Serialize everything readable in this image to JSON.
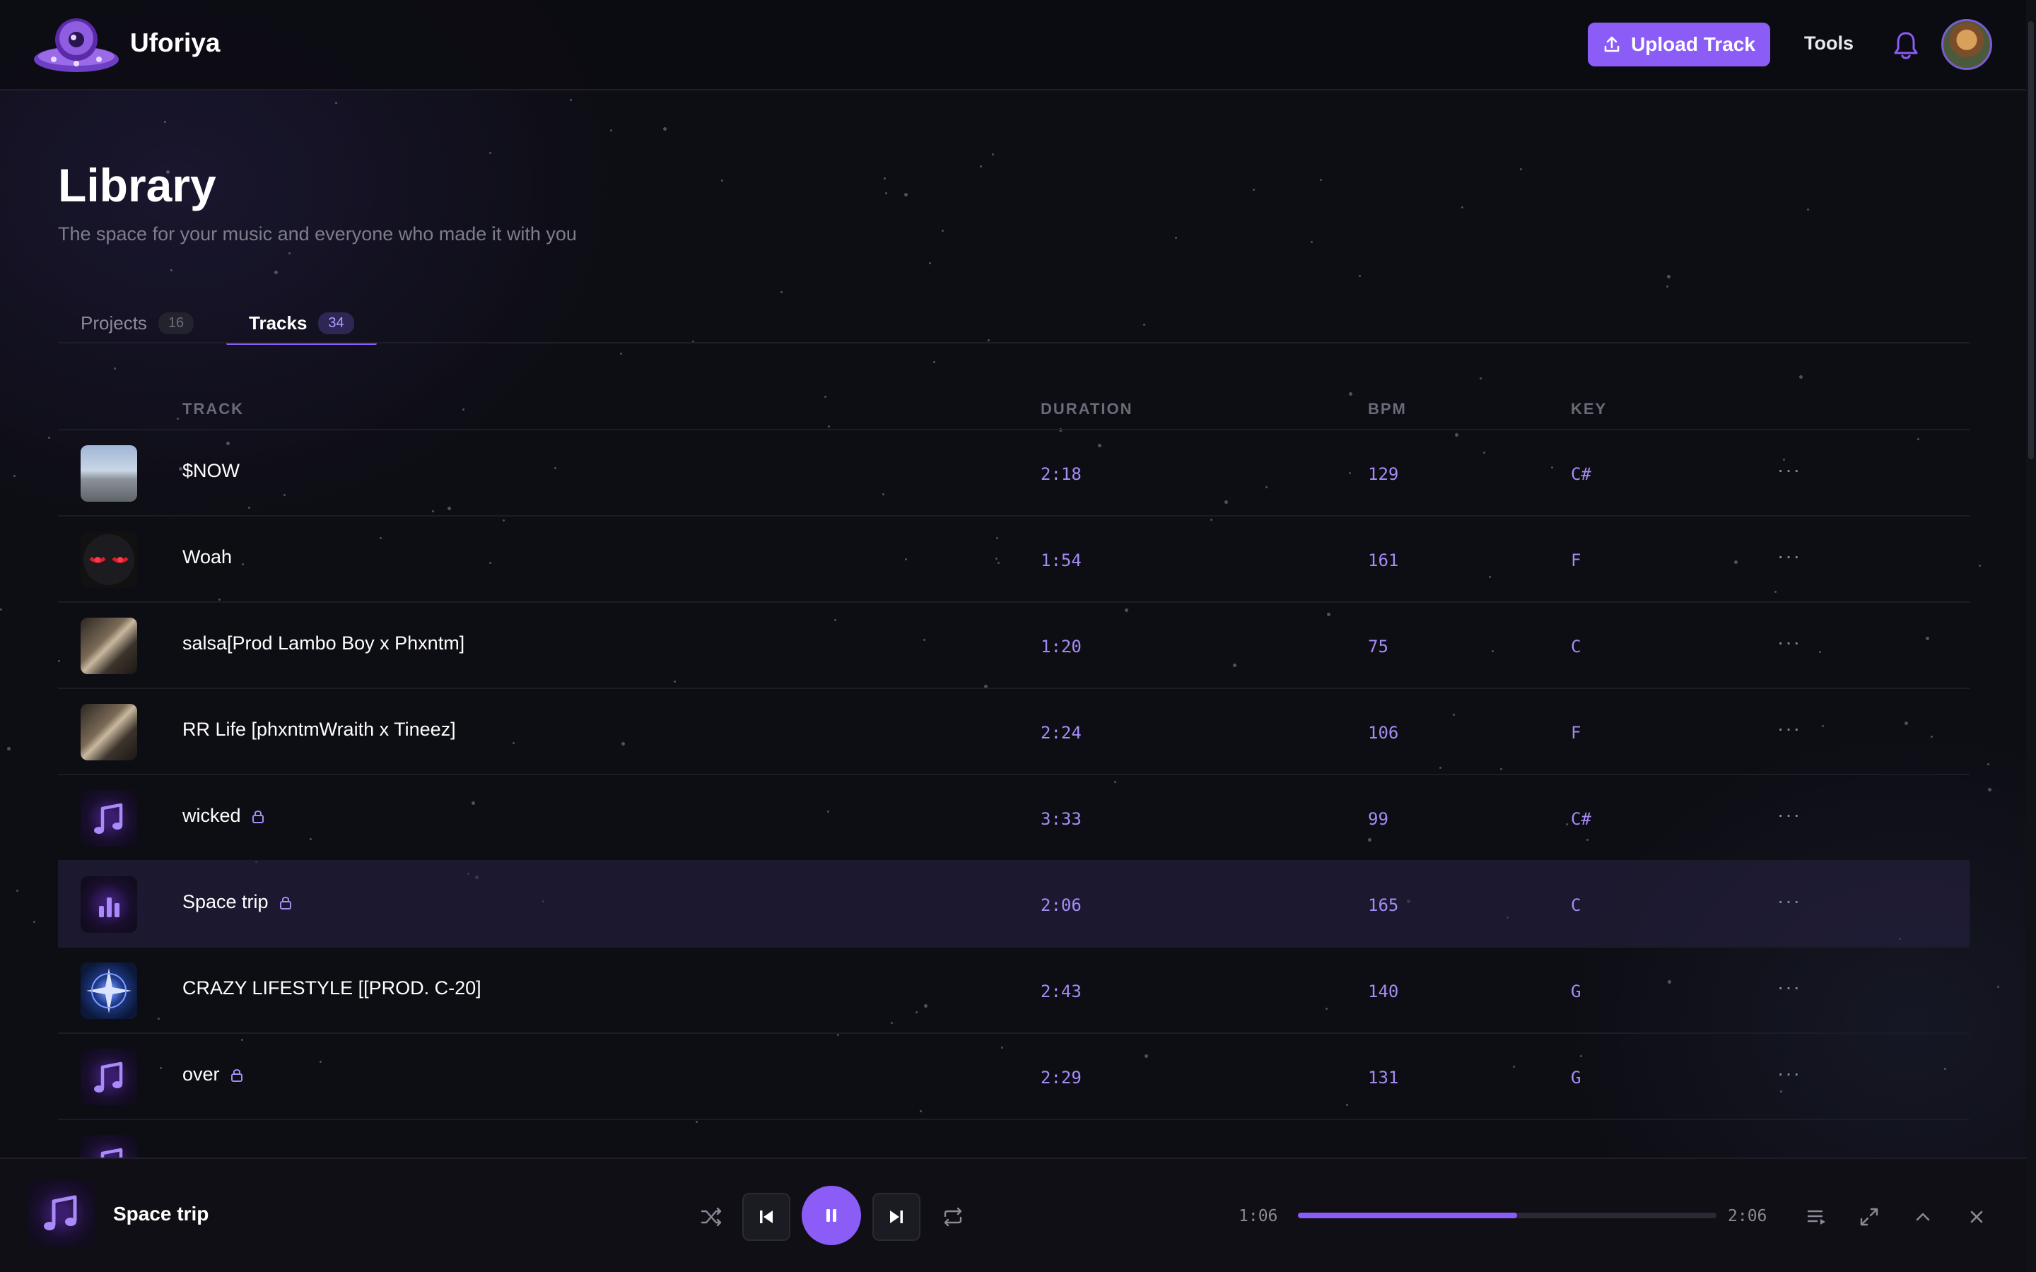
{
  "app": {
    "name": "Uforiya"
  },
  "header": {
    "upload_label": "Upload Track",
    "tools_label": "Tools"
  },
  "page": {
    "title": "Library",
    "subtitle": "The space for your music and everyone who made it with you"
  },
  "tabs": [
    {
      "label": "Projects",
      "count": "16",
      "active": false
    },
    {
      "label": "Tracks",
      "count": "34",
      "active": true
    }
  ],
  "table": {
    "columns": {
      "track": "TRACK",
      "duration": "DURATION",
      "bpm": "BPM",
      "key": "KEY"
    },
    "rows": [
      {
        "name": "$NOW",
        "duration": "2:18",
        "bpm": "129",
        "key": "C#",
        "locked": false,
        "art": "sky-photo"
      },
      {
        "name": "Woah",
        "duration": "1:54",
        "bpm": "161",
        "key": "F",
        "locked": false,
        "art": "red-eyes-face"
      },
      {
        "name": "salsa[Prod Lambo Boy x Phxntm]",
        "duration": "1:20",
        "bpm": "75",
        "key": "C",
        "locked": false,
        "art": "room-photo"
      },
      {
        "name": "RR Life [phxntmWraith x Tineez]",
        "duration": "2:24",
        "bpm": "106",
        "key": "F",
        "locked": false,
        "art": "room-photo"
      },
      {
        "name": "wicked",
        "duration": "3:33",
        "bpm": "99",
        "key": "C#",
        "locked": true,
        "art": "music-note-icon"
      },
      {
        "name": "Space trip",
        "duration": "2:06",
        "bpm": "165",
        "key": "C",
        "locked": true,
        "art": "equalizer-icon",
        "playing": true
      },
      {
        "name": "CRAZY LIFESTYLE [[PROD. C-20]",
        "duration": "2:43",
        "bpm": "140",
        "key": "G",
        "locked": false,
        "art": "compass-star"
      },
      {
        "name": "over",
        "duration": "2:29",
        "bpm": "131",
        "key": "G",
        "locked": true,
        "art": "music-note-icon"
      }
    ]
  },
  "player": {
    "title": "Space trip",
    "current_time": "1:06",
    "total_time": "2:06",
    "progress": 0.524
  },
  "colors": {
    "accent": "#8b5cf6",
    "background": "#0d0d14",
    "mono_value": "#a58cf4"
  }
}
